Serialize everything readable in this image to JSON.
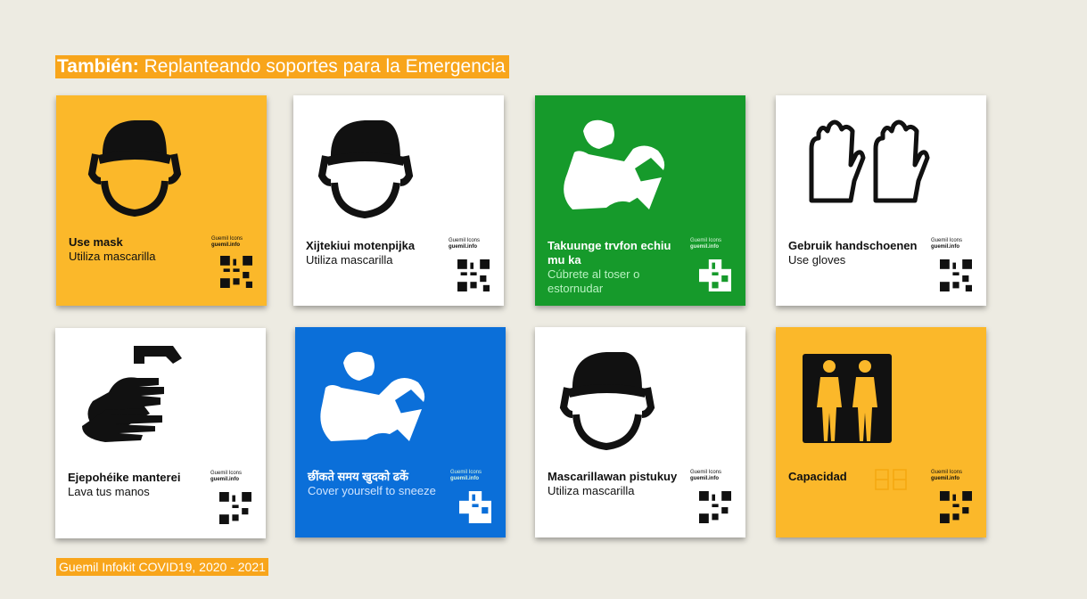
{
  "title": {
    "bold": "También:",
    "rest": " Replanteando soportes para la Emergencia"
  },
  "footer": "Guemil Infokit COVID19, 2020 - 2021",
  "credit": {
    "line1": "Guemil Icons",
    "line2": "guemil.info"
  },
  "cards": [
    {
      "main": "Use mask",
      "sub": "Utiliza mascarilla",
      "icon": "mask-face-icon",
      "bg": "#fbb82a"
    },
    {
      "main": "Xijtekiui motenpijka",
      "sub": "Utiliza mascarilla",
      "icon": "mask-face-icon",
      "bg": "#ffffff"
    },
    {
      "main": "Takuunge trvfon echiu mu ka",
      "sub": "Cúbrete al toser o estornudar",
      "icon": "cough-cover-icon",
      "bg": "#169a2b"
    },
    {
      "main": "Gebruik handschoenen",
      "sub": "Use gloves",
      "icon": "gloves-icon",
      "bg": "#ffffff"
    },
    {
      "main": "Ejepohéike manterei",
      "sub": "Lava tus manos",
      "icon": "wash-hands-icon",
      "bg": "#ffffff"
    },
    {
      "main": "छींकते समय खुदको ढकें",
      "sub": "Cover yourself to sneeze",
      "icon": "cough-cover-icon",
      "bg": "#0b6fd9"
    },
    {
      "main": "Mascarillawan pistukuy",
      "sub": "Utiliza mascarilla",
      "icon": "mask-face-icon",
      "bg": "#ffffff"
    },
    {
      "main": "Capacidad",
      "sub": "",
      "icon": "capacity-icon",
      "bg": "#fbb82a"
    }
  ]
}
